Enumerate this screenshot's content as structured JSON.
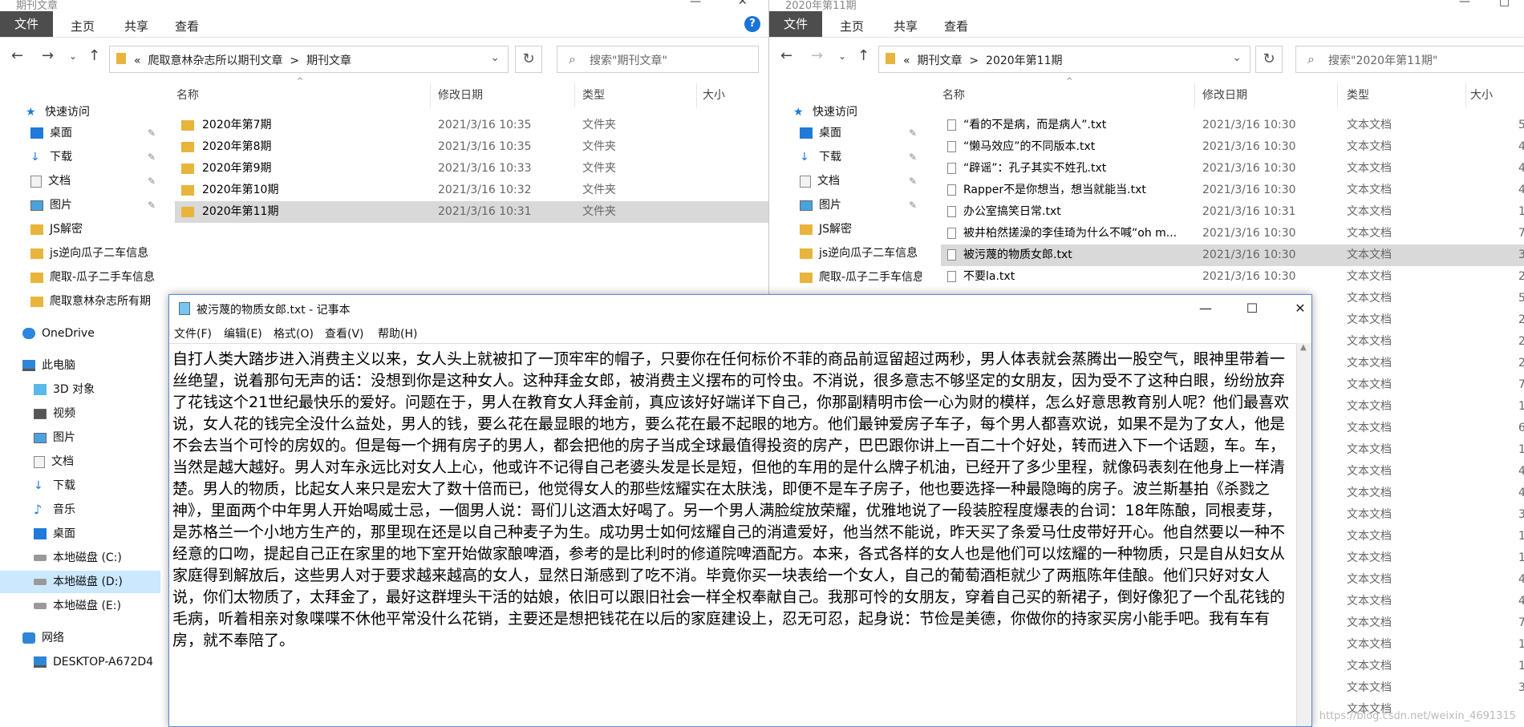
{
  "left_explorer": {
    "title": "期刊文章",
    "ribbon_tabs": [
      "文件",
      "主页",
      "共享",
      "查看"
    ],
    "breadcrumb": [
      "«",
      "爬取意林杂志所以期刊文章",
      ">",
      "期刊文章"
    ],
    "search_placeholder": "搜索\"期刊文章\"",
    "columns": [
      "名称",
      "修改日期",
      "类型",
      "大小"
    ],
    "nav": {
      "quick_access": "快速访问",
      "pinned": [
        "桌面",
        "下载",
        "文档",
        "图片"
      ],
      "folders": [
        "JS解密",
        "js逆向瓜子二车信息",
        "爬取-瓜子二手车信息",
        "爬取意林杂志所有期"
      ],
      "onedrive": "OneDrive",
      "this_pc": "此电脑",
      "pc_items": [
        "3D 对象",
        "视频",
        "图片",
        "文档",
        "下载",
        "音乐",
        "桌面"
      ],
      "drives": [
        "本地磁盘 (C:)",
        "本地磁盘 (D:)",
        "本地磁盘 (E:)"
      ],
      "network": "网络",
      "computer": "DESKTOP-A672D4"
    },
    "files": [
      {
        "name": "2020年第7期",
        "date": "2021/3/16 10:35",
        "type": "文件夹"
      },
      {
        "name": "2020年第8期",
        "date": "2021/3/16 10:35",
        "type": "文件夹"
      },
      {
        "name": "2020年第9期",
        "date": "2021/3/16 10:33",
        "type": "文件夹"
      },
      {
        "name": "2020年第10期",
        "date": "2021/3/16 10:32",
        "type": "文件夹"
      },
      {
        "name": "2020年第11期",
        "date": "2021/3/16 10:31",
        "type": "文件夹"
      }
    ]
  },
  "right_explorer": {
    "title": "2020年第11期",
    "ribbon_tabs": [
      "文件",
      "主页",
      "共享",
      "查看"
    ],
    "breadcrumb": [
      "«",
      "期刊文章",
      ">",
      "2020年第11期"
    ],
    "search_placeholder": "搜索\"2020年第11期\"",
    "columns": [
      "名称",
      "修改日期",
      "类型",
      "大小"
    ],
    "nav": {
      "quick_access": "快速访问",
      "pinned": [
        "桌面",
        "下载",
        "文档",
        "图片"
      ],
      "folders": [
        "JS解密",
        "js逆向瓜子二车信息",
        "爬取-瓜子二手车信息"
      ]
    },
    "files": [
      {
        "name": "“看的不是病，而是病人”.txt",
        "date": "2021/3/16 10:30",
        "type": "文本文档",
        "size": "5"
      },
      {
        "name": "“懒马效应”的不同版本.txt",
        "date": "2021/3/16 10:30",
        "type": "文本文档",
        "size": "4"
      },
      {
        "name": "“辟谣”：孔子其实不姓孔.txt",
        "date": "2021/3/16 10:30",
        "type": "文本文档",
        "size": "4"
      },
      {
        "name": "Rapper不是你想当，想当就能当.txt",
        "date": "2021/3/16 10:30",
        "type": "文本文档",
        "size": "4"
      },
      {
        "name": "办公室搞笑日常.txt",
        "date": "2021/3/16 10:31",
        "type": "文本文档",
        "size": "1"
      },
      {
        "name": "被井柏然搓澡的李佳琦为什么不喊“oh m...",
        "date": "2021/3/16 10:30",
        "type": "文本文档",
        "size": "7"
      },
      {
        "name": "被污蔑的物质女郎.txt",
        "date": "2021/3/16 10:30",
        "type": "文本文档",
        "size": "3"
      },
      {
        "name": "不要la.txt",
        "date": "2021/3/16 10:30",
        "type": "文本文档",
        "size": "2"
      }
    ],
    "extra_types": [
      "文本文档",
      "文本文档",
      "文本文档",
      "文本文档",
      "文本文档",
      "文本文档",
      "文本文档",
      "文本文档",
      "文本文档",
      "文本文档",
      "文本文档",
      "文本文档",
      "文本文档",
      "文本文档",
      "文本文档",
      "文本文档",
      "文本文档",
      "文本文档",
      "文本文档",
      "文本文档"
    ],
    "extra_sizes": [
      "5",
      "2",
      "2",
      "2",
      "7",
      "1",
      "6",
      "1",
      "4",
      "4",
      "3",
      "1",
      "1",
      "4",
      "4",
      "7",
      "1",
      "1",
      "3",
      ""
    ]
  },
  "notepad": {
    "title": "被污蔑的物质女郎.txt - 记事本",
    "menu": [
      "文件(F)",
      "编辑(E)",
      "格式(O)",
      "查看(V)",
      "帮助(H)"
    ],
    "content": "自打人类大踏步进入消费主义以来，女人头上就被扣了一顶牢牢的帽子，只要你在任何标价不菲的商品前逗留超过两秒，男人体表就会蒸腾出一股空气，眼神里带着一丝绝望，说着那句无声的话：没想到你是这种女人。这种拜金女郎，被消费主义摆布的可怜虫。不消说，很多意志不够坚定的女朋友，因为受不了这种白眼，纷纷放弃了花钱这个21世纪最快乐的爱好。问题在于，男人在教育女人拜金前，真应该好好端详下自己，你那副精明市侩一心为财的模样，怎么好意思教育别人呢？他们最喜欢说，女人花的钱完全没什么益处，男人的钱，要么花在最显眼的地方，要么花在最不起眼的地方。他们最钟爱房子车子，每个男人都喜欢说，如果不是为了女人，他是不会去当个可怜的房奴的。但是每一个拥有房子的男人，都会把他的房子当成全球最值得投资的房产，巴巴跟你讲上一百二十个好处，转而进入下一个话题，车。车，当然是越大越好。男人对车永远比对女人上心，他或许不记得自己老婆头发是长是短，但他的车用的是什么牌子机油，已经开了多少里程，就像码表刻在他身上一样清楚。男人的物质，比起女人来只是宏大了数十倍而已，他觉得女人的那些炫耀实在太肤浅，即便不是车子房子，他也要选择一种最隐晦的房子。波兰斯基拍《杀戮之神》，里面两个中年男人开始喝威士忌，一個男人说：哥们儿这酒太好喝了。另一个男人满脸绽放荣耀，优雅地说了一段装腔程度爆表的台词：18年陈酿，同根麦芽，是苏格兰一个小地方生产的，那里现在还是以自己种麦子为生。成功男士如何炫耀自己的消遣爱好，他当然不能说，昨天买了条爱马仕皮带好开心。他自然要以一种不经意的口吻，提起自己正在家里的地下室开始做家酿啤酒，参考的是比利时的修道院啤酒配方。本来，各式各样的女人也是他们可以炫耀的一种物质，只是自从妇女从家庭得到解放后，这些男人对于要求越来越高的女人，显然日渐感到了吃不消。毕竟你买一块表给一个女人，自己的葡萄酒柜就少了两瓶陈年佳酿。他们只好对女人说，你们太物质了，太拜金了，最好这群埋头干活的姑娘，依旧可以跟旧社会一样全权奉献自己。我那可怜的女朋友，穿着自己买的新裙子，倒好像犯了一个乱花钱的毛病，听着相亲对象喋喋不休他平常没什么花销，主要还是想把钱花在以后的家庭建设上，忍无可忍，起身说：节俭是美德，你做你的持家买房小能手吧。我有车有房，就不奉陪了。"
  },
  "watermark": "https://blog.csdn.net/weixin_4691315"
}
